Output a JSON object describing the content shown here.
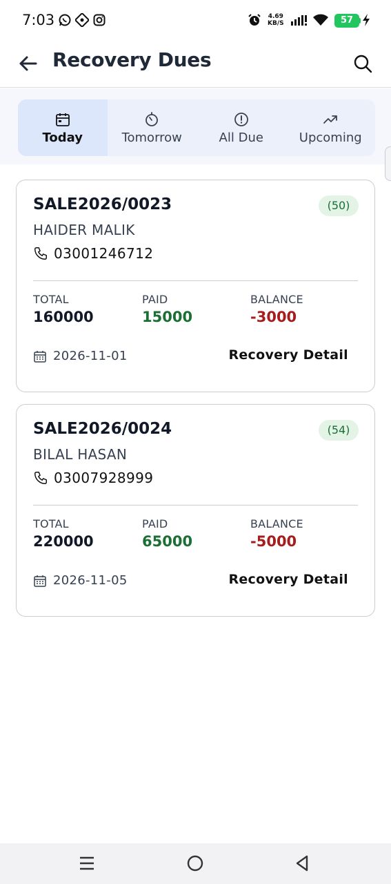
{
  "status_bar": {
    "time": "7:03",
    "net_speed_value": "4.69",
    "net_speed_unit": "KB/S",
    "battery": "57",
    "icons": [
      "whatsapp-icon",
      "app-icon",
      "instagram-icon",
      "alarm-icon",
      "signal-icon",
      "wifi-icon",
      "charging-icon"
    ]
  },
  "header": {
    "title": "Recovery Dues"
  },
  "tabs": [
    {
      "label": "Today",
      "icon": "calendar-icon",
      "active": true
    },
    {
      "label": "Tomorrow",
      "icon": "timer-icon",
      "active": false
    },
    {
      "label": "All Due",
      "icon": "alert-circle-icon",
      "active": false
    },
    {
      "label": "Upcoming",
      "icon": "trending-up-icon",
      "active": false
    }
  ],
  "labels": {
    "total": "TOTAL",
    "paid": "PAID",
    "balance": "BALANCE",
    "detail_button": "Recovery Detail"
  },
  "colors": {
    "paid": "#1b6f35",
    "balance": "#a51d1d",
    "badge_bg": "#e3f3e6",
    "active_tab": "#dce7fb"
  },
  "records": [
    {
      "sale_no": "SALE2026/0023",
      "badge": "(50)",
      "customer": "HAIDER MALIK",
      "phone": "03001246712",
      "total": "160000",
      "paid": "15000",
      "balance": "-3000",
      "date": "2026-11-01"
    },
    {
      "sale_no": "SALE2026/0024",
      "badge": "(54)",
      "customer": "BILAL HASAN",
      "phone": "03007928999",
      "total": "220000",
      "paid": "65000",
      "balance": "-5000",
      "date": "2026-11-05"
    }
  ]
}
